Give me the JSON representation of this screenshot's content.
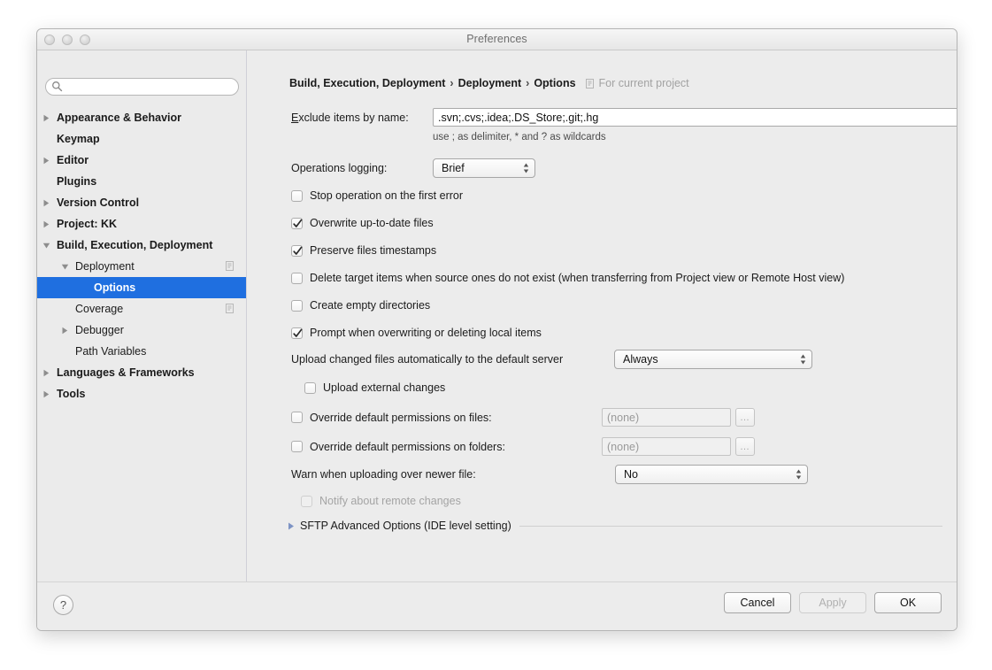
{
  "window": {
    "title": "Preferences",
    "traffic_lights": [
      "close",
      "minimize",
      "zoom"
    ]
  },
  "sidebar": {
    "search": {
      "value": "",
      "placeholder": ""
    },
    "items": [
      {
        "label": "Appearance & Behavior",
        "indent": 0,
        "twisty": "collapsed",
        "bold": true,
        "selected": false,
        "badge": false
      },
      {
        "label": "Keymap",
        "indent": 0,
        "twisty": "none",
        "bold": true,
        "selected": false,
        "badge": false
      },
      {
        "label": "Editor",
        "indent": 0,
        "twisty": "collapsed",
        "bold": true,
        "selected": false,
        "badge": false
      },
      {
        "label": "Plugins",
        "indent": 0,
        "twisty": "none",
        "bold": true,
        "selected": false,
        "badge": false
      },
      {
        "label": "Version Control",
        "indent": 0,
        "twisty": "collapsed",
        "bold": true,
        "selected": false,
        "badge": false
      },
      {
        "label": "Project: KK",
        "indent": 0,
        "twisty": "collapsed",
        "bold": true,
        "selected": false,
        "badge": false
      },
      {
        "label": "Build, Execution, Deployment",
        "indent": 0,
        "twisty": "expanded",
        "bold": true,
        "selected": false,
        "badge": false
      },
      {
        "label": "Deployment",
        "indent": 1,
        "twisty": "expanded",
        "bold": false,
        "selected": false,
        "badge": true
      },
      {
        "label": "Options",
        "indent": 2,
        "twisty": "none",
        "bold": true,
        "selected": true,
        "badge": false
      },
      {
        "label": "Coverage",
        "indent": 1,
        "twisty": "none",
        "bold": false,
        "selected": false,
        "badge": true
      },
      {
        "label": "Debugger",
        "indent": 1,
        "twisty": "collapsed",
        "bold": false,
        "selected": false,
        "badge": false
      },
      {
        "label": "Path Variables",
        "indent": 1,
        "twisty": "none",
        "bold": false,
        "selected": false,
        "badge": false
      },
      {
        "label": "Languages & Frameworks",
        "indent": 0,
        "twisty": "collapsed",
        "bold": true,
        "selected": false,
        "badge": false
      },
      {
        "label": "Tools",
        "indent": 0,
        "twisty": "collapsed",
        "bold": true,
        "selected": false,
        "badge": false
      }
    ]
  },
  "breadcrumb": {
    "part1": "Build, Execution, Deployment",
    "sep1": "›",
    "part2": "Deployment",
    "sep2": "›",
    "part3": "Options",
    "scope_note": "For current project"
  },
  "form": {
    "exclude": {
      "label_mnemonic": "E",
      "label_rest": "xclude items by name:",
      "value": ".svn;.cvs;.idea;.DS_Store;.git;.hg",
      "placeholder": "",
      "hint": "use ; as delimiter, * and ? as wildcards"
    },
    "operations_logging": {
      "label": "Operations logging:",
      "value": "Brief"
    },
    "checkboxes": [
      {
        "label": "Stop operation on the first error",
        "checked": false,
        "enabled": true
      },
      {
        "label": "Overwrite up-to-date files",
        "checked": true,
        "enabled": true
      },
      {
        "label": "Preserve files timestamps",
        "checked": true,
        "enabled": true
      },
      {
        "label": "Delete target items when source ones do not exist (when transferring from Project view or Remote Host view)",
        "checked": false,
        "enabled": true
      },
      {
        "label": "Create empty directories",
        "checked": false,
        "enabled": true
      },
      {
        "label": "Prompt when overwriting or deleting local items",
        "checked": true,
        "enabled": true
      }
    ],
    "upload_auto": {
      "label": "Upload changed files automatically to the default server",
      "value": "Always"
    },
    "upload_external": {
      "label": "Upload external changes",
      "checked": false,
      "enabled": true
    },
    "override_files": {
      "label": "Override default permissions on files:",
      "checked": false,
      "value": "(none)",
      "browse_label": "…"
    },
    "override_folders": {
      "label": "Override default permissions on folders:",
      "checked": false,
      "value": "(none)",
      "browse_label": "…"
    },
    "warn_newer": {
      "label": "Warn when uploading over newer file:",
      "value": "No"
    },
    "notify_remote": {
      "label": "Notify about remote changes",
      "checked": false,
      "enabled": false
    },
    "sftp_advanced": {
      "label": "SFTP Advanced Options (IDE level setting)",
      "expanded": false
    }
  },
  "footer": {
    "help_label": "?",
    "cancel_label": "Cancel",
    "apply_label": "Apply",
    "apply_enabled": false,
    "ok_label": "OK"
  },
  "colors": {
    "selection": "#1f6fe0",
    "window_bg": "#ececec",
    "sidebar_bg": "#ebebeb",
    "disabled_text": "#a4a4a4"
  }
}
